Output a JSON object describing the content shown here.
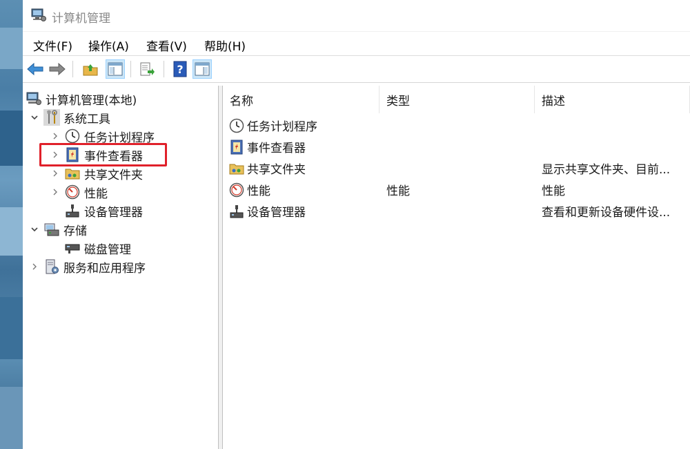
{
  "window": {
    "title": "计算机管理"
  },
  "menu": [
    "文件(F)",
    "操作(A)",
    "查看(V)",
    "帮助(H)"
  ],
  "toolbar": {
    "buttons": [
      "back-icon",
      "forward-icon",
      "up-folder-icon",
      "show-hide-tree-icon",
      "export-list-icon",
      "help-icon",
      "show-action-pane-icon"
    ]
  },
  "tree": {
    "root": "计算机管理(本地)",
    "system_tools": "系统工具",
    "task_scheduler": "任务计划程序",
    "event_viewer": "事件查看器",
    "shared_folders": "共享文件夹",
    "performance": "性能",
    "device_manager": "设备管理器",
    "storage": "存储",
    "disk_management": "磁盘管理",
    "services_apps": "服务和应用程序"
  },
  "list": {
    "columns": [
      "名称",
      "类型",
      "描述"
    ],
    "rows": [
      {
        "name": "任务计划程序",
        "type": "",
        "desc": ""
      },
      {
        "name": "事件查看器",
        "type": "",
        "desc": ""
      },
      {
        "name": "共享文件夹",
        "type": "",
        "desc": "显示共享文件夹、目前..."
      },
      {
        "name": "性能",
        "type": "性能",
        "desc": "性能"
      },
      {
        "name": "设备管理器",
        "type": "",
        "desc": "查看和更新设备硬件设..."
      }
    ]
  },
  "colors": {
    "highlight": "#e0202a",
    "selection": "#cde6f7"
  }
}
